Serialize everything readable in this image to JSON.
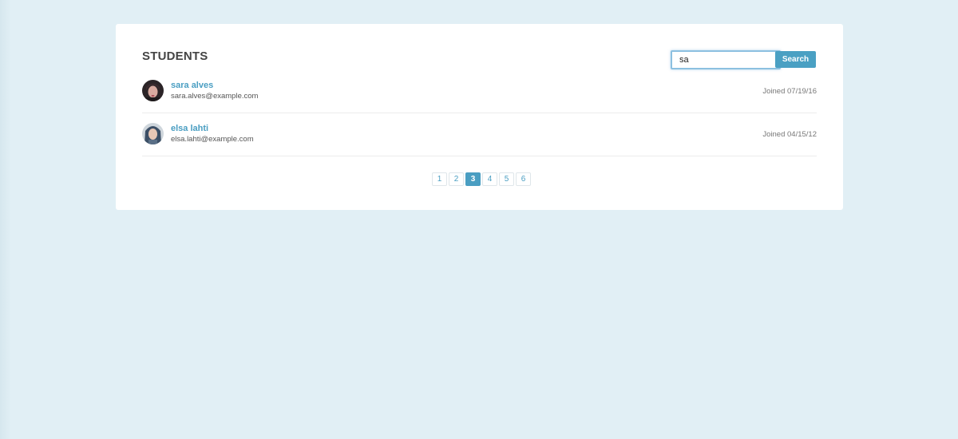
{
  "header": {
    "title": "STUDENTS"
  },
  "search": {
    "value": "sa",
    "button_label": "Search"
  },
  "students": [
    {
      "name": "sara alves",
      "email": "sara.alves@example.com",
      "joined": "Joined 07/19/16"
    },
    {
      "name": "elsa lahti",
      "email": "elsa.lahti@example.com",
      "joined": "Joined 04/15/12"
    }
  ],
  "pagination": {
    "pages": [
      "1",
      "2",
      "3",
      "4",
      "5",
      "6"
    ],
    "current": "3"
  },
  "colors": {
    "accent": "#4a9ec2",
    "background": "#e1eff5",
    "card": "#ffffff"
  },
  "icons": [
    "avatar-sara-icon",
    "avatar-elsa-icon"
  ]
}
